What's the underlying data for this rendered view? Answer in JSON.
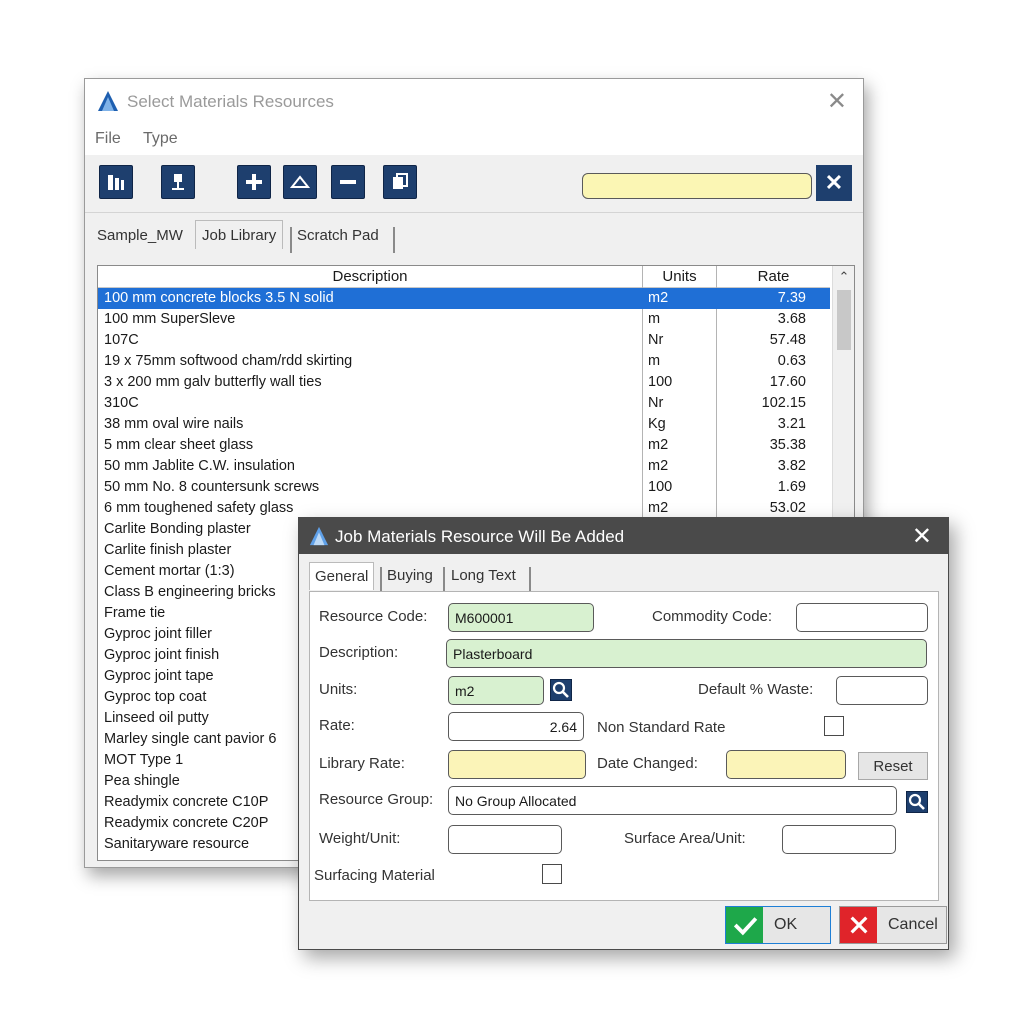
{
  "main_window": {
    "title": "Select Materials Resources",
    "menu": [
      "File",
      "Type"
    ],
    "search": {
      "value": "",
      "placeholder": ""
    },
    "tabs": [
      "Sample_MW",
      "Job Library",
      "Scratch Pad"
    ],
    "active_tab": "Job Library",
    "table": {
      "headers": [
        "Description",
        "Units",
        "Rate"
      ],
      "rows": [
        {
          "desc": "100 mm concrete blocks 3.5 N solid",
          "unit": "m2",
          "rate": "7.39",
          "selected": true
        },
        {
          "desc": "100 mm SuperSleve",
          "unit": "m",
          "rate": "3.68"
        },
        {
          "desc": "107C",
          "unit": "Nr",
          "rate": "57.48"
        },
        {
          "desc": "19 x 75mm softwood cham/rdd skirting",
          "unit": "m",
          "rate": "0.63"
        },
        {
          "desc": "3 x 200 mm galv butterfly wall ties",
          "unit": "100",
          "rate": "17.60"
        },
        {
          "desc": "310C",
          "unit": "Nr",
          "rate": "102.15"
        },
        {
          "desc": "38 mm oval wire nails",
          "unit": "Kg",
          "rate": "3.21"
        },
        {
          "desc": "5 mm clear sheet glass",
          "unit": "m2",
          "rate": "35.38"
        },
        {
          "desc": "50 mm Jablite C.W. insulation",
          "unit": "m2",
          "rate": "3.82"
        },
        {
          "desc": "50 mm No. 8 countersunk screws",
          "unit": "100",
          "rate": "1.69"
        },
        {
          "desc": "6 mm toughened safety glass",
          "unit": "m2",
          "rate": "53.02"
        },
        {
          "desc": "Carlite Bonding plaster",
          "unit": "",
          "rate": ""
        },
        {
          "desc": "Carlite finish plaster",
          "unit": "",
          "rate": ""
        },
        {
          "desc": "Cement mortar (1:3)",
          "unit": "",
          "rate": ""
        },
        {
          "desc": "Class B engineering bricks",
          "unit": "",
          "rate": ""
        },
        {
          "desc": "Frame tie",
          "unit": "",
          "rate": ""
        },
        {
          "desc": "Gyproc joint filler",
          "unit": "",
          "rate": ""
        },
        {
          "desc": "Gyproc joint finish",
          "unit": "",
          "rate": ""
        },
        {
          "desc": "Gyproc joint tape",
          "unit": "",
          "rate": ""
        },
        {
          "desc": "Gyproc top coat",
          "unit": "",
          "rate": ""
        },
        {
          "desc": "Linseed oil putty",
          "unit": "",
          "rate": ""
        },
        {
          "desc": "Marley single cant pavior 6",
          "unit": "",
          "rate": ""
        },
        {
          "desc": "MOT Type 1",
          "unit": "",
          "rate": ""
        },
        {
          "desc": "Pea shingle",
          "unit": "",
          "rate": ""
        },
        {
          "desc": "Readymix concrete C10P",
          "unit": "",
          "rate": ""
        },
        {
          "desc": "Readymix concrete C20P",
          "unit": "",
          "rate": ""
        },
        {
          "desc": "Sanitaryware resource",
          "unit": "",
          "rate": ""
        }
      ]
    }
  },
  "dialog": {
    "title": "Job Materials Resource Will Be Added",
    "tabs": [
      "General",
      "Buying",
      "Long Text"
    ],
    "active_tab": "General",
    "labels": {
      "resource_code": "Resource Code:",
      "commodity_code": "Commodity Code:",
      "description": "Description:",
      "units": "Units:",
      "default_waste": "Default % Waste:",
      "rate": "Rate:",
      "non_standard_rate": "Non Standard Rate",
      "library_rate": "Library Rate:",
      "date_changed": "Date Changed:",
      "resource_group": "Resource Group:",
      "weight_unit": "Weight/Unit:",
      "surface_area_unit": "Surface Area/Unit:",
      "surfacing_material": "Surfacing Material"
    },
    "values": {
      "resource_code": "M600001",
      "commodity_code": "",
      "description": "Plasterboard",
      "units": "m2",
      "default_waste": "",
      "rate": "2.64",
      "library_rate": "",
      "date_changed": "",
      "resource_group": "No Group Allocated",
      "weight_unit": "",
      "surface_area_unit": ""
    },
    "non_standard_rate_checked": false,
    "surfacing_material_checked": false,
    "reset_label": "Reset",
    "ok_label": "OK",
    "cancel_label": "Cancel"
  },
  "colors": {
    "toolbar_button": "#1e3f6e",
    "selected_row": "#1f6fd6",
    "field_required": "#d8f1d0",
    "field_readonly": "#fbf4b8",
    "ok_icon": "#1ea84a",
    "cancel_icon": "#e0242a"
  },
  "icons": {
    "toolbar": [
      "library-select-icon",
      "pin-icon",
      "add-icon",
      "edit-icon",
      "remove-icon",
      "copy-icon"
    ],
    "lookup": "magnifier-icon"
  }
}
